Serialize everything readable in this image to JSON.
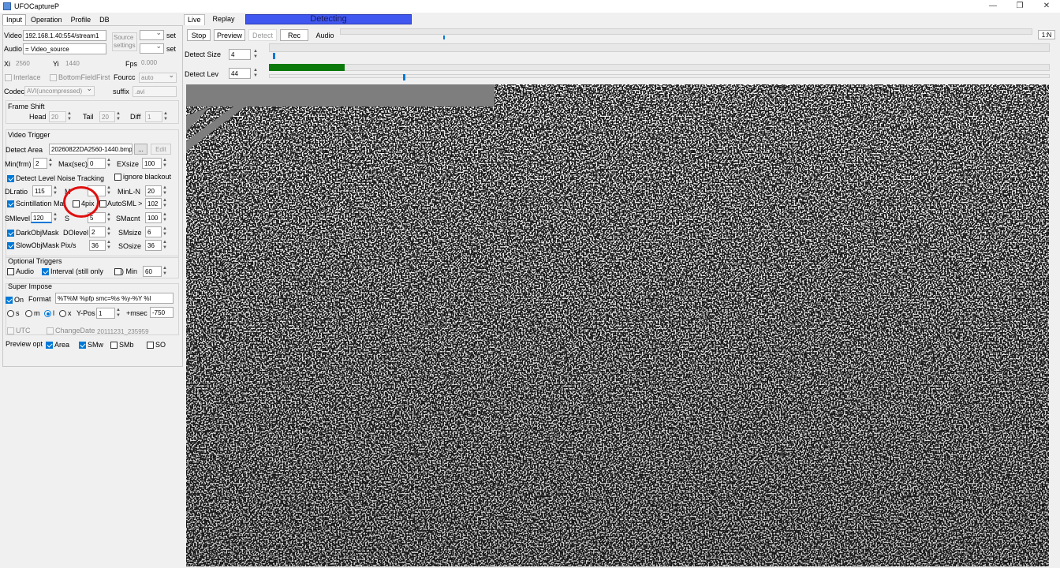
{
  "window": {
    "title": "UFOCaptureP",
    "minimize": "—",
    "maximize": "❐",
    "close": "✕"
  },
  "left_tabs": [
    "Input",
    "Operation",
    "Profile",
    "DB"
  ],
  "input": {
    "video_label": "Video",
    "video_value": "192.168.1.40:554/stream1",
    "audio_label": "Audio",
    "audio_value": "= Video_source",
    "source_settings": "Source settings",
    "set1": "set",
    "set2": "set",
    "xi_label": "Xi",
    "xi_value": "2560",
    "yi_label": "Yi",
    "yi_value": "1440",
    "fps_label": "Fps",
    "fps_value": "0.000",
    "interlace": "Interlace",
    "bottom_field": "BottomFieldFirst",
    "fourcc_label": "Fourcc",
    "fourcc_value": "auto",
    "codec_label": "Codec",
    "codec_value": "AVI(uncompressed)",
    "suffix_label": "suffix",
    "suffix_value": ".avi"
  },
  "frame_shift": {
    "title": "Frame Shift",
    "head_label": "Head",
    "head_value": "20",
    "tail_label": "Tail",
    "tail_value": "20",
    "diff_label": "Diff",
    "diff_value": "1"
  },
  "video_trigger": {
    "title": "Video Trigger",
    "detect_area_label": "Detect Area",
    "detect_area_value": "20260822DA2560-1440.bmp",
    "browse": "...",
    "edit": "Edit",
    "min_frm_label": "Min(frm)",
    "min_frm_value": "2",
    "max_sec_label": "Max(sec)",
    "max_sec_value": "0",
    "exsize_label": "EXsize",
    "exsize_value": "100",
    "detect_level_noise": "Detect Level Noise Tracking",
    "ignore_blackout": "ignore blackout",
    "dratio_label": "DLratio",
    "dratio_value": "115",
    "mlevel_label": "M",
    "mlevel_value": "",
    "minl_label": "MinL-N",
    "minl_value": "20",
    "scint_label": "Scintillation Ma",
    "fourpix": "4pix",
    "autosml": "AutoSML >",
    "autosml_value": "102",
    "smlevel_label": "SMlevel",
    "smlevel_value": "120",
    "s_label": "S",
    "s_value": "5",
    "smacnt_label": "SMacnt",
    "smacnt_value": "100",
    "darkobj": "DarkObjMask",
    "dolevel_label": "DOlevel",
    "dolevel_value": "2",
    "smsize_label": "SMsize",
    "smsize_value": "6",
    "slowobj": "SlowObjMask",
    "pixs_label": "Pix/s",
    "pixs_value": "36",
    "sosize_label": "SOsize",
    "sosize_value": "36"
  },
  "optional": {
    "title": "Optional Triggers",
    "audio": "Audio",
    "interval": "Interval (still only",
    "min_label": ") Min",
    "min_value": "60"
  },
  "superimpose": {
    "title": "Super Impose",
    "on": "On",
    "format_label": "Format",
    "format_value": "%T%M        %pfp  smc=%s  %y-%Y %l",
    "r_s": "s",
    "r_m": "m",
    "r_l": "l",
    "r_x": "x",
    "ypos_label": "Y-Pos",
    "ypos_value": "1",
    "msec_label": "+msec",
    "msec_value": "-750",
    "utc": "UTC",
    "change_date": "ChangeDate",
    "change_date_value": "20111231_235959",
    "preview_label": "Preview opt",
    "area": "Area",
    "smw": "SMw",
    "smb": "SMb",
    "so": "SO"
  },
  "right": {
    "tabs": [
      "Live",
      "Replay"
    ],
    "status": "Detecting",
    "stop": "Stop",
    "preview": "Preview",
    "detect": "Detect",
    "rec": "Rec",
    "audio": "Audio",
    "ratio": "1:N",
    "detect_size_label": "Detect Size",
    "detect_size_value": "4",
    "detect_lev_label": "Detect Lev",
    "detect_lev_value": "44"
  },
  "colors": {
    "status_bar": "#4057f0",
    "level_bar": "#0b7a0b",
    "annotation_circle": "#e01010",
    "accent": "#0078d7"
  }
}
